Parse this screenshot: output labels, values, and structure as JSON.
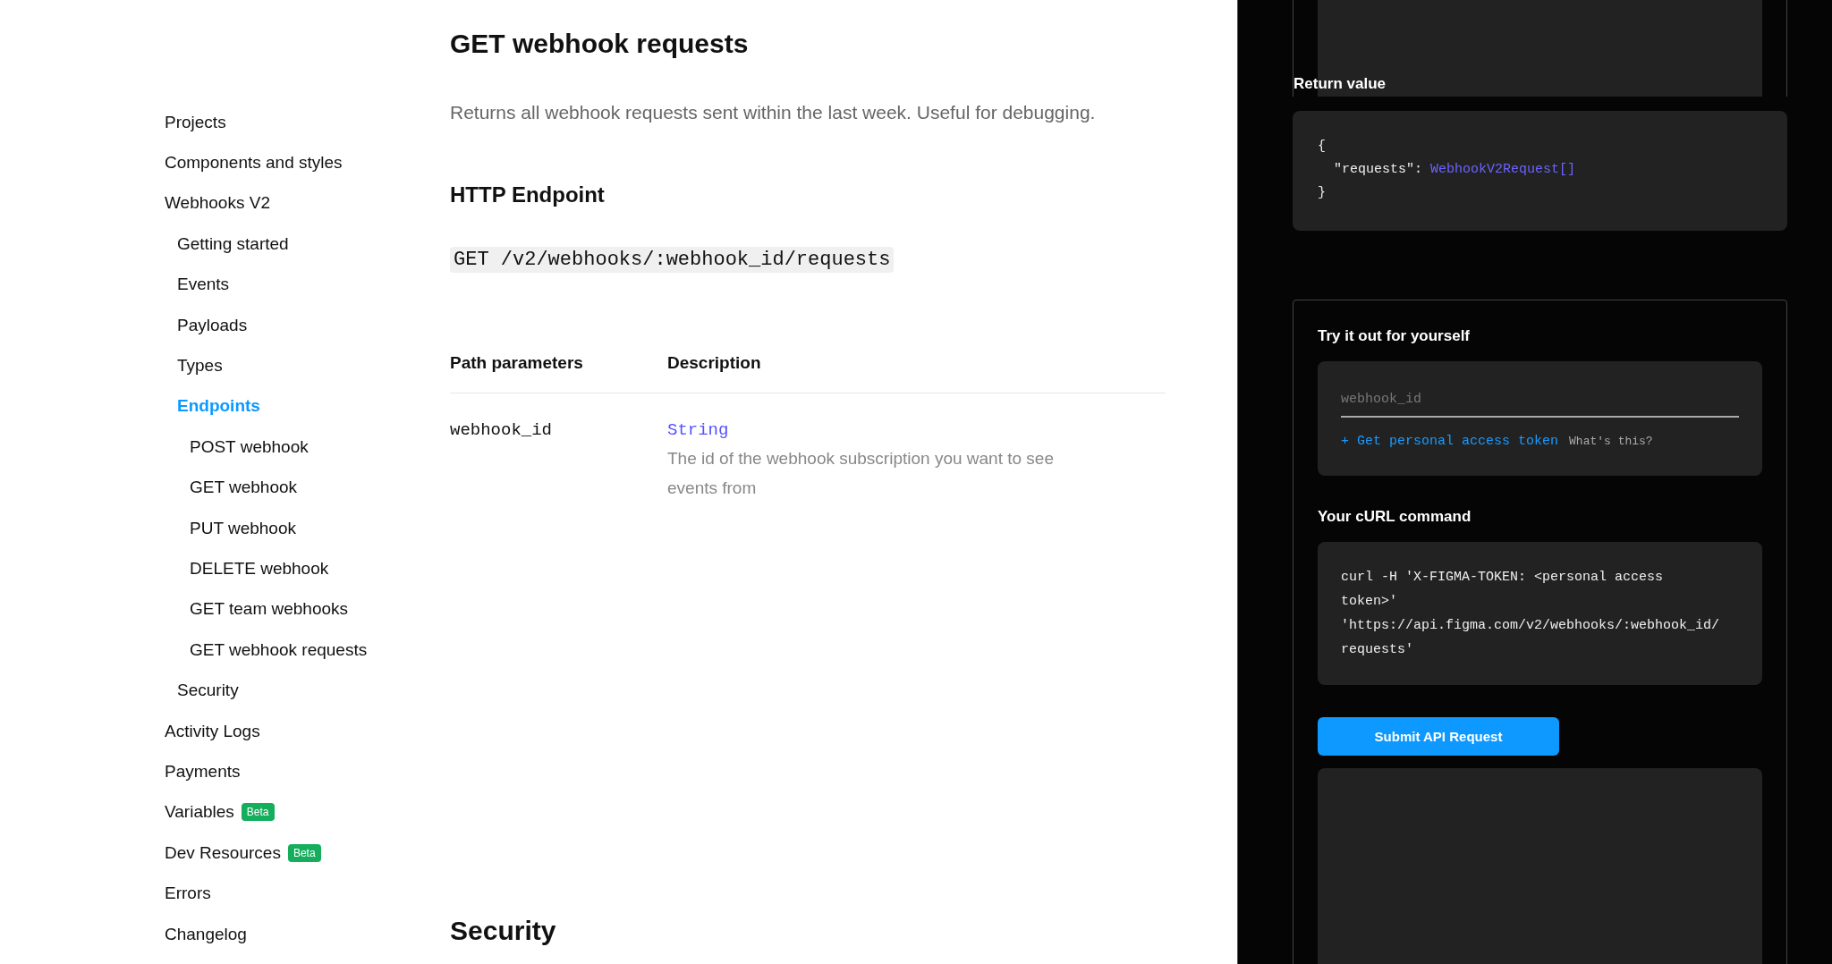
{
  "sidebar": {
    "items": [
      {
        "label": "Projects",
        "selected": false
      },
      {
        "label": "Components and styles",
        "selected": false
      },
      {
        "label": "Webhooks V2",
        "selected": false,
        "children": [
          {
            "label": "Getting started",
            "selected": false
          },
          {
            "label": "Events",
            "selected": false
          },
          {
            "label": "Payloads",
            "selected": false
          },
          {
            "label": "Types",
            "selected": false
          },
          {
            "label": "Endpoints",
            "selected": true,
            "children": [
              {
                "label": "POST webhook",
                "selected": false
              },
              {
                "label": "GET webhook",
                "selected": false
              },
              {
                "label": "PUT webhook",
                "selected": false
              },
              {
                "label": "DELETE webhook",
                "selected": false
              },
              {
                "label": "GET team webhooks",
                "selected": false
              },
              {
                "label": "GET webhook requests",
                "selected": false
              }
            ]
          },
          {
            "label": "Security",
            "selected": false
          }
        ]
      },
      {
        "label": "Activity Logs",
        "selected": false
      },
      {
        "label": "Payments",
        "selected": false
      },
      {
        "label": "Variables",
        "selected": false,
        "badge": "Beta"
      },
      {
        "label": "Dev Resources",
        "selected": false,
        "badge": "Beta"
      },
      {
        "label": "Errors",
        "selected": false
      },
      {
        "label": "Changelog",
        "selected": false
      }
    ]
  },
  "main": {
    "title": "GET webhook requests",
    "description": "Returns all webhook requests sent within the last week. Useful for debugging.",
    "endpoint_heading": "HTTP Endpoint",
    "endpoint": "GET /v2/webhooks/:webhook_id/requests",
    "table": {
      "columns": [
        "Path parameters",
        "Description"
      ],
      "rows": [
        {
          "name": "webhook_id",
          "type": "String",
          "description": "The id of the webhook subscription you want to see events from"
        }
      ]
    },
    "next_heading": "Security"
  },
  "panel": {
    "return_label": "Return value",
    "return_code": [
      {
        "text": "{"
      },
      {
        "text": "  \"requests\": ",
        "type_ref": "WebhookV2Request[]"
      },
      {
        "text": "}"
      }
    ],
    "try": {
      "title": "Try it out for yourself",
      "field": {
        "placeholder": "webhook_id"
      },
      "token_link": "+ Get personal access token",
      "help_link": "What's this?",
      "curl_heading": "Your cURL command",
      "curl_lines": [
        "curl -H 'X-FIGMA-TOKEN: <personal access",
        "token>'",
        "'https://api.figma.com/v2/webhooks/:webhook_id/",
        "requests'"
      ],
      "submit": "Submit API Request"
    }
  }
}
